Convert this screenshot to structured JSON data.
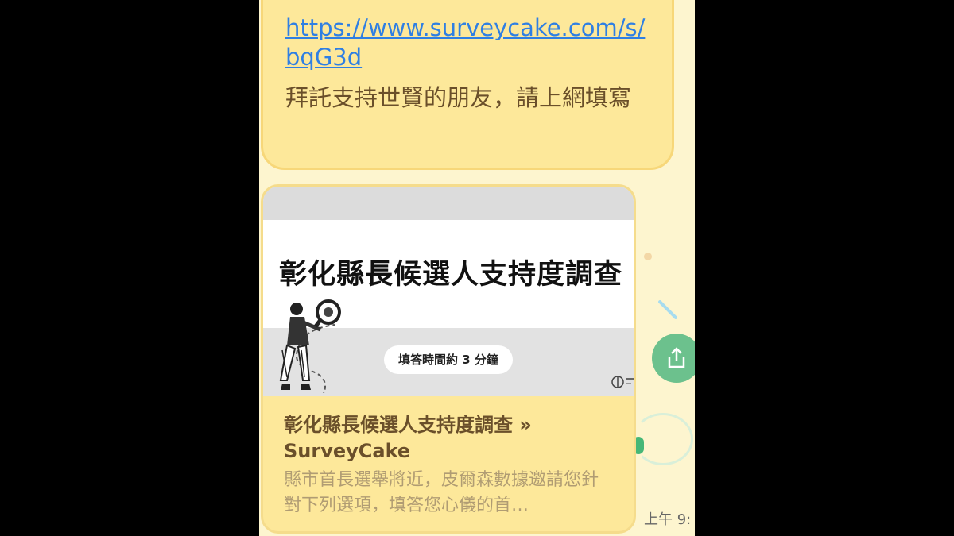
{
  "message": {
    "link_text": "https://www.surveycake.com/s/bqG3d",
    "text": "拜託支持世賢的朋友，請上網填寫"
  },
  "link_preview": {
    "banner_title": "彰化縣長候選人支持度調查",
    "banner_pill": "填答時間約 3 分鐘",
    "title": "彰化縣長候選人支持度調查 » SurveyCake",
    "description": "縣市首長選舉將近，皮爾森數據邀請您針對下列選項，填答您心儀的首…"
  },
  "meta": {
    "timestamp": "上午 9:"
  },
  "icons": {
    "share": "share-icon"
  },
  "colors": {
    "bubble": "#fde89a",
    "link": "#2f7fe3",
    "share": "#6cc18d"
  }
}
